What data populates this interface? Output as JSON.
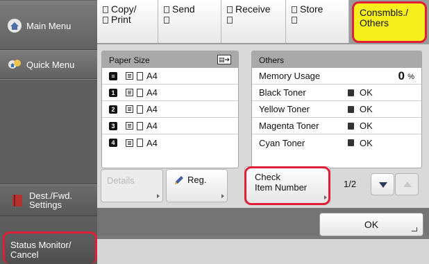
{
  "sidebar": {
    "main_menu": "Main Menu",
    "quick_menu": "Quick Menu",
    "dest_fwd_line1": "Dest./Fwd.",
    "dest_fwd_line2": "Settings",
    "status_line1": "Status Monitor/",
    "status_line2": "Cancel"
  },
  "tabs": [
    {
      "line1": "Copy/",
      "line2": "Print"
    },
    {
      "line1": "Send",
      "line2": ""
    },
    {
      "line1": "Receive",
      "line2": ""
    },
    {
      "line1": "Store",
      "line2": ""
    },
    {
      "line1": "Consmbls./",
      "line2": "Others"
    }
  ],
  "paper": {
    "header": "Paper Size",
    "drawers": [
      {
        "icon": "≡",
        "size": "A4"
      },
      {
        "icon": "1",
        "size": "A4"
      },
      {
        "icon": "2",
        "size": "A4"
      },
      {
        "icon": "3",
        "size": "A4"
      },
      {
        "icon": "4",
        "size": "A4"
      }
    ]
  },
  "others": {
    "header": "Others",
    "memory_label": "Memory Usage",
    "memory_value": "0",
    "memory_unit": "%",
    "toners": [
      {
        "label": "Black Toner",
        "status": "OK"
      },
      {
        "label": "Yellow Toner",
        "status": "OK"
      },
      {
        "label": "Magenta Toner",
        "status": "OK"
      },
      {
        "label": "Cyan Toner",
        "status": "OK"
      }
    ]
  },
  "buttons": {
    "details": "Details",
    "reg": "Reg.",
    "check_line1": "Check",
    "check_line2": "Item Number",
    "ok": "OK"
  },
  "paging": {
    "indicator": "1/2"
  },
  "colors": {
    "highlight": "#e01e36",
    "active_tab": "#f7ee1e"
  }
}
